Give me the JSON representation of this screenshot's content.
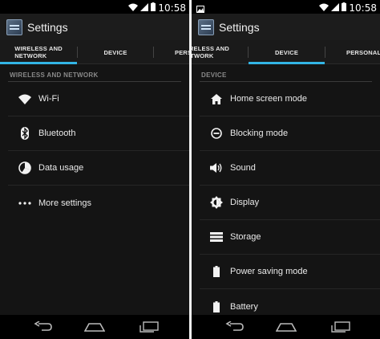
{
  "left": {
    "status": {
      "time": "10:58"
    },
    "actionbar": {
      "title": "Settings"
    },
    "tabs": [
      {
        "line1": "WIRELESS AND",
        "line2": "NETWORK",
        "selected": true
      },
      {
        "line1": "DEVICE",
        "line2": "",
        "selected": false
      },
      {
        "line1": "PERSO",
        "line2": "",
        "selected": false
      }
    ],
    "section_header": "WIRELESS AND NETWORK",
    "items": [
      {
        "label": "Wi-Fi",
        "icon": "wifi-icon"
      },
      {
        "label": "Bluetooth",
        "icon": "bluetooth-icon"
      },
      {
        "label": "Data usage",
        "icon": "data-usage-icon"
      },
      {
        "label": "More settings",
        "icon": "more-icon"
      }
    ]
  },
  "right": {
    "status": {
      "time": "10:58"
    },
    "actionbar": {
      "title": "Settings"
    },
    "tabs": [
      {
        "line1": "WIRELESS AND",
        "line2": "NETWORK",
        "selected": false
      },
      {
        "line1": "DEVICE",
        "line2": "",
        "selected": true
      },
      {
        "line1": "PERSONAL",
        "line2": "",
        "selected": false
      }
    ],
    "section_header": "DEVICE",
    "items": [
      {
        "label": "Home screen mode",
        "icon": "home-icon"
      },
      {
        "label": "Blocking mode",
        "icon": "blocking-icon"
      },
      {
        "label": "Sound",
        "icon": "speaker-icon"
      },
      {
        "label": "Display",
        "icon": "brightness-icon"
      },
      {
        "label": "Storage",
        "icon": "storage-icon"
      },
      {
        "label": "Power saving mode",
        "icon": "battery-icon"
      },
      {
        "label": "Battery",
        "icon": "battery-icon"
      }
    ]
  },
  "colors": {
    "accent": "#33b5e5",
    "background": "#141414",
    "text": "#eaeaea",
    "header": "#8a8a8a"
  }
}
